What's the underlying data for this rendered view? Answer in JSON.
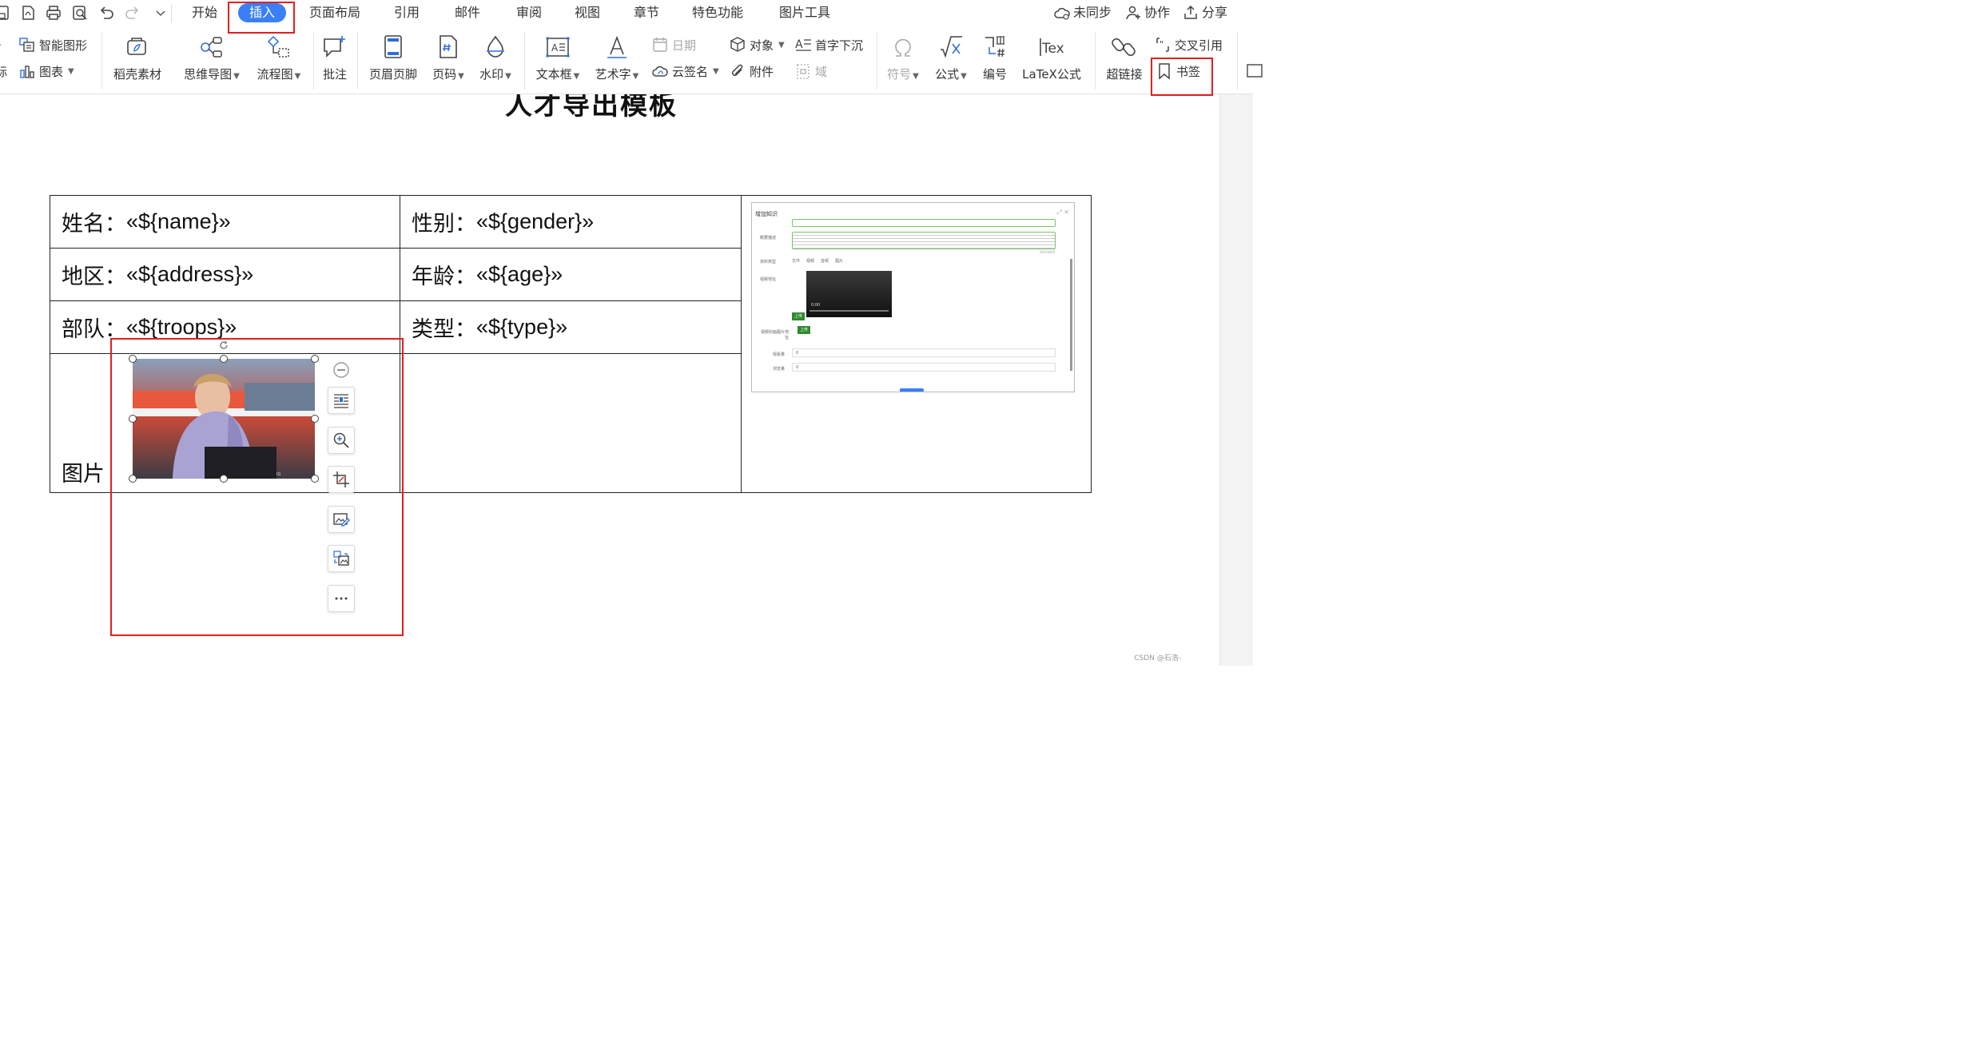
{
  "menubar": {
    "tabs": [
      {
        "label": "开始"
      },
      {
        "label": "插入"
      },
      {
        "label": "页面布局"
      },
      {
        "label": "引用"
      },
      {
        "label": "邮件"
      },
      {
        "label": "审阅"
      },
      {
        "label": "视图"
      },
      {
        "label": "章节"
      },
      {
        "label": "特色功能"
      },
      {
        "label": "图片工具"
      }
    ],
    "sync_status": "未同步",
    "collaborate": "协作",
    "share": "分享"
  },
  "ribbon": {
    "smart_shape": "智能图形",
    "chart": "图表",
    "edge_left_top": "",
    "edge_left_bottom": "标",
    "docer_material": "稻壳素材",
    "mind_map": "思维导图",
    "flowchart": "流程图",
    "comment": "批注",
    "header_footer": "页眉页脚",
    "page_number": "页码",
    "watermark": "水印",
    "text_box": "文本框",
    "word_art": "艺术字",
    "date": "日期",
    "cloud_sign": "云签名",
    "object": "对象",
    "attachment": "附件",
    "drop_cap": "首字下沉",
    "field": "域",
    "symbol": "符号",
    "formula": "公式",
    "numbering": "编号",
    "latex": "LaTeX公式",
    "hyperlink": "超链接",
    "cross_reference": "交叉引用",
    "bookmark": "书签"
  },
  "document": {
    "title": "人才导出模板",
    "rows": [
      {
        "l_label": "姓名：",
        "l_value": "«${name}»",
        "r_label": "性别：",
        "r_value": "«${gender}»"
      },
      {
        "l_label": "地区：",
        "l_value": "«${address}»",
        "r_label": "年龄：",
        "r_value": "«${age}»"
      },
      {
        "l_label": "部队：",
        "l_value": "«${troops}»",
        "r_label": "类型：",
        "r_value": "«${type}»"
      }
    ],
    "picture_label": "图片"
  },
  "embedded_screenshot": {
    "dialog_title": "增加知识",
    "label_summary": "概要描述",
    "counter": "293/3000",
    "label_type": "资料类型",
    "types": [
      "文件",
      "视频",
      "音频",
      "图片"
    ],
    "label_video": "视频地址",
    "video_time": "0:00",
    "upload": "上传",
    "label_cover": "视频封面图片地址",
    "label_views": "观看量",
    "views_value": "0",
    "label_browse": "浏览量",
    "browse_value": "0"
  },
  "watermark_text": "CSDN @石浩-",
  "colors": {
    "accent": "#3a7ff6",
    "annotation": "#e02020"
  }
}
